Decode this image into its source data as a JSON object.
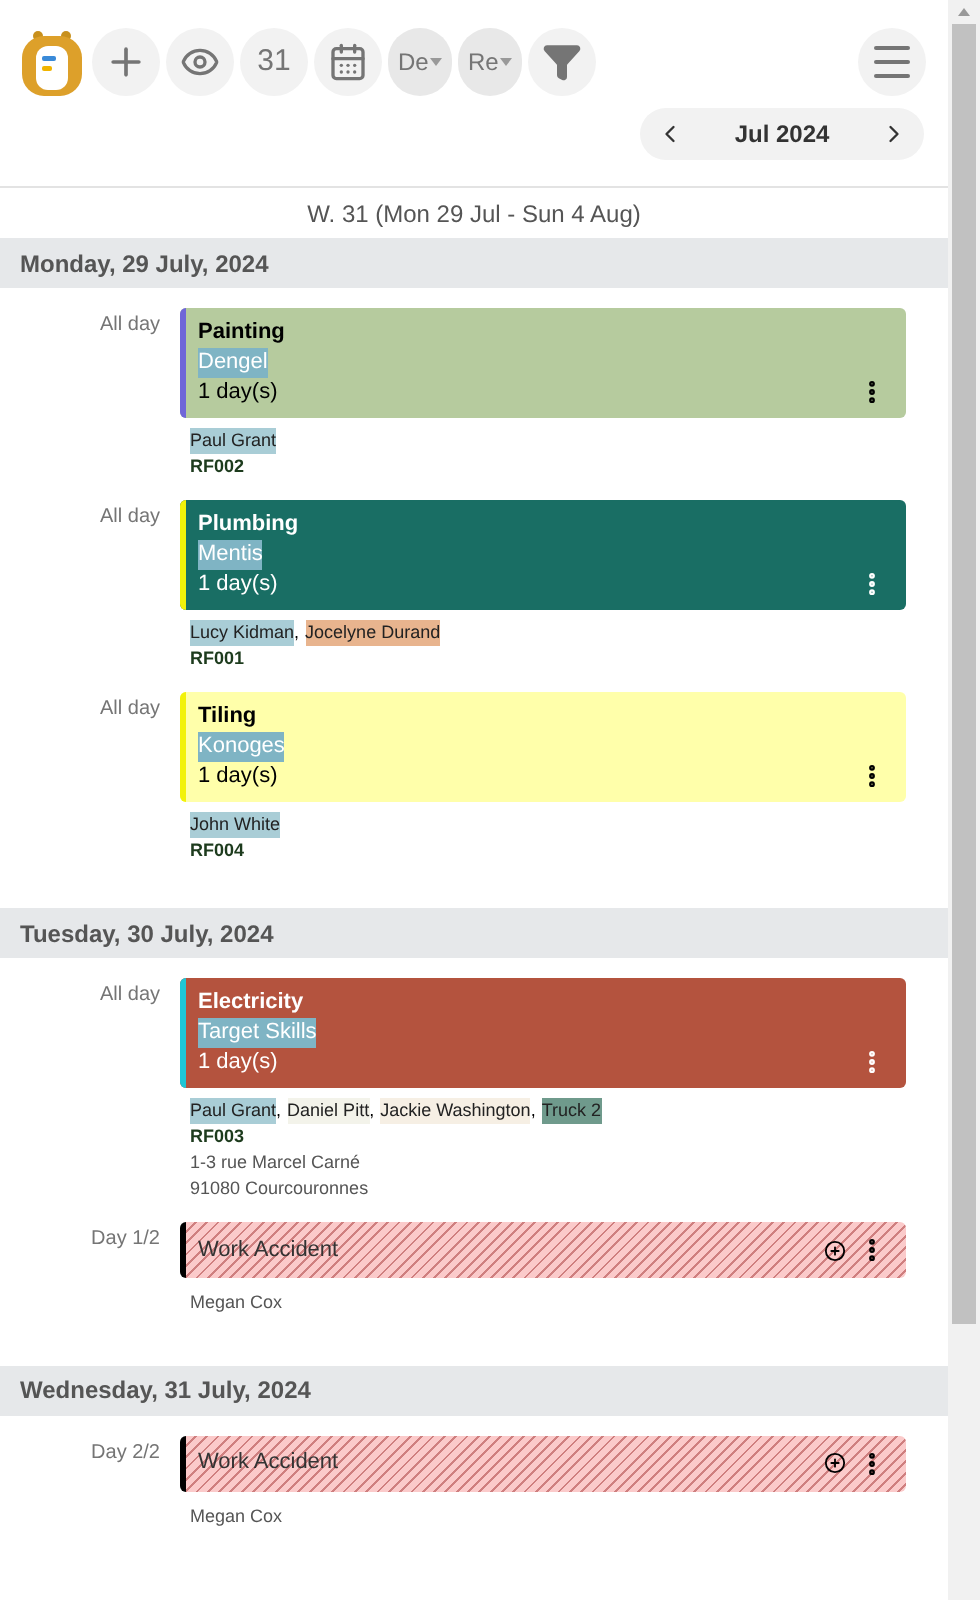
{
  "toolbar": {
    "today_button": "31",
    "dropdowns": [
      {
        "label": "De"
      },
      {
        "label": "Re"
      }
    ]
  },
  "month_nav": {
    "label": "Jul 2024"
  },
  "week_label": "W. 31 (Mon 29 Jul - Sun 4 Aug)",
  "days": [
    {
      "header": "Monday, 29 July, 2024",
      "events": [
        {
          "kind": "job",
          "time": "All day",
          "title": "Painting",
          "client": "Dengel",
          "duration": "1 day(s)",
          "color": "#b6cb9e",
          "stripe": {
            "color": "#6f66d8"
          },
          "dark": false,
          "resources": [
            {
              "name": "Paul Grant",
              "color": "#a9cdd6"
            }
          ],
          "ref": "RF002"
        },
        {
          "kind": "job",
          "time": "All day",
          "title": "Plumbing",
          "client": "Mentis",
          "duration": "1 day(s)",
          "color": "#196e64",
          "stripe": {
            "color": "#f2f20a"
          },
          "dark": true,
          "resources": [
            {
              "name": "Lucy Kidman",
              "color": "#a9cdd6",
              "separator": ","
            },
            {
              "name": "Jocelyne Durand",
              "color": "#e8b48e"
            }
          ],
          "ref": "RF001"
        },
        {
          "kind": "job",
          "time": "All day",
          "title": "Tiling",
          "client": "Konoges",
          "duration": "1 day(s)",
          "color": "#ffffaa",
          "stripe": {
            "color": "#f2f20a"
          },
          "dark": false,
          "resources": [
            {
              "name": "John White",
              "color": "#a9cdd6"
            }
          ],
          "ref": "RF004"
        }
      ]
    },
    {
      "header": "Tuesday, 30 July, 2024",
      "events": [
        {
          "kind": "job",
          "time": "All day",
          "title": "Electricity",
          "client": "Target Skills",
          "duration": "1 day(s)",
          "color": "#b4533e",
          "stripe": {
            "color": "#1fc6d6"
          },
          "dark": true,
          "resources": [
            {
              "name": "Paul Grant",
              "color": "#a9cdd6",
              "separator": ","
            },
            {
              "name": "Daniel Pitt",
              "color": "#f3f3ea",
              "separator": ","
            },
            {
              "name": "Jackie Washington",
              "color": "#f6efe4",
              "separator": ","
            },
            {
              "name": "Truck 2",
              "color": "#6f9a8c"
            }
          ],
          "ref": "RF003",
          "address": [
            "1-3 rue Marcel Carné",
            "91080 Courcouronnes"
          ]
        },
        {
          "kind": "absence",
          "time": "Day 1/2",
          "title": "Work Accident",
          "person": "Megan Cox"
        }
      ]
    },
    {
      "header": "Wednesday, 31 July, 2024",
      "events": [
        {
          "kind": "absence",
          "time": "Day 2/2",
          "title": "Work Accident",
          "person": "Megan Cox"
        }
      ]
    }
  ]
}
